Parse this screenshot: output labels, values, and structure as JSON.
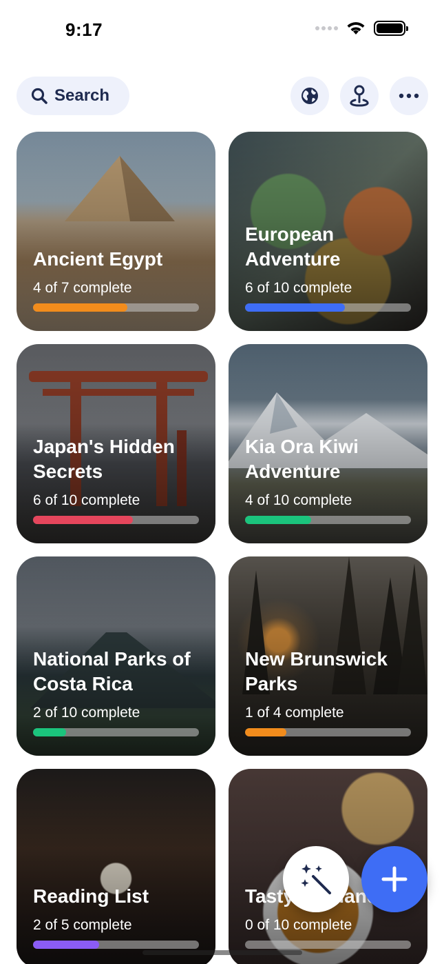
{
  "status_bar": {
    "time": "9:17"
  },
  "toolbar": {
    "search_label": "Search",
    "buttons": [
      "globe-icon",
      "map-pin-icon",
      "more-icon"
    ]
  },
  "colors": {
    "accent_blue": "#3e6df5",
    "pill_bg": "#eef1fb",
    "icon_navy": "#1e2a4f"
  },
  "trips": [
    {
      "title": "Ancient Egypt",
      "progress_text": "4 of 7 complete",
      "progress": 0.57,
      "bar_color": "#f28c1c"
    },
    {
      "title": "European Adventure",
      "progress_text": "6 of 10 complete",
      "progress": 0.6,
      "bar_color": "#3e6df5"
    },
    {
      "title": "Japan's Hidden Secrets",
      "progress_text": "6 of 10 complete",
      "progress": 0.6,
      "bar_color": "#e5465c"
    },
    {
      "title": "Kia Ora Kiwi Adventure",
      "progress_text": "4 of 10 complete",
      "progress": 0.4,
      "bar_color": "#1bc47d"
    },
    {
      "title": "National Parks of Costa Rica",
      "progress_text": "2 of 10 complete",
      "progress": 0.2,
      "bar_color": "#1bc47d"
    },
    {
      "title": "New Brunswick Parks",
      "progress_text": "1 of 4 complete",
      "progress": 0.25,
      "bar_color": "#f28c1c"
    },
    {
      "title": "Reading List",
      "progress_text": "2 of 5 complete",
      "progress": 0.4,
      "bar_color": "#8b5cf6"
    },
    {
      "title": "Tasty Thailand",
      "progress_text": "0 of 10 complete",
      "progress": 0.0,
      "bar_color": "#1bc47d"
    }
  ],
  "fabs": {
    "magic": "magic-wand-icon",
    "add": "plus-icon"
  }
}
